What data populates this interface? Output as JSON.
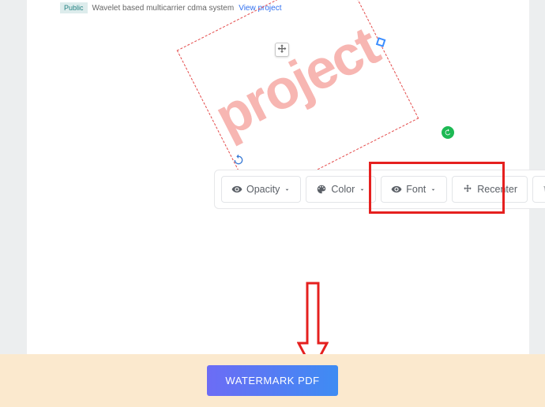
{
  "document": {
    "badge": "Public",
    "description": "Wavelet based multicarrier cdma system",
    "link": "View project"
  },
  "watermark": {
    "text": "project"
  },
  "toolbar": {
    "opacity": "Opacity",
    "color": "Color",
    "font": "Font",
    "recenter": "Recenter"
  },
  "action": {
    "submit": "WATERMARK PDF"
  }
}
